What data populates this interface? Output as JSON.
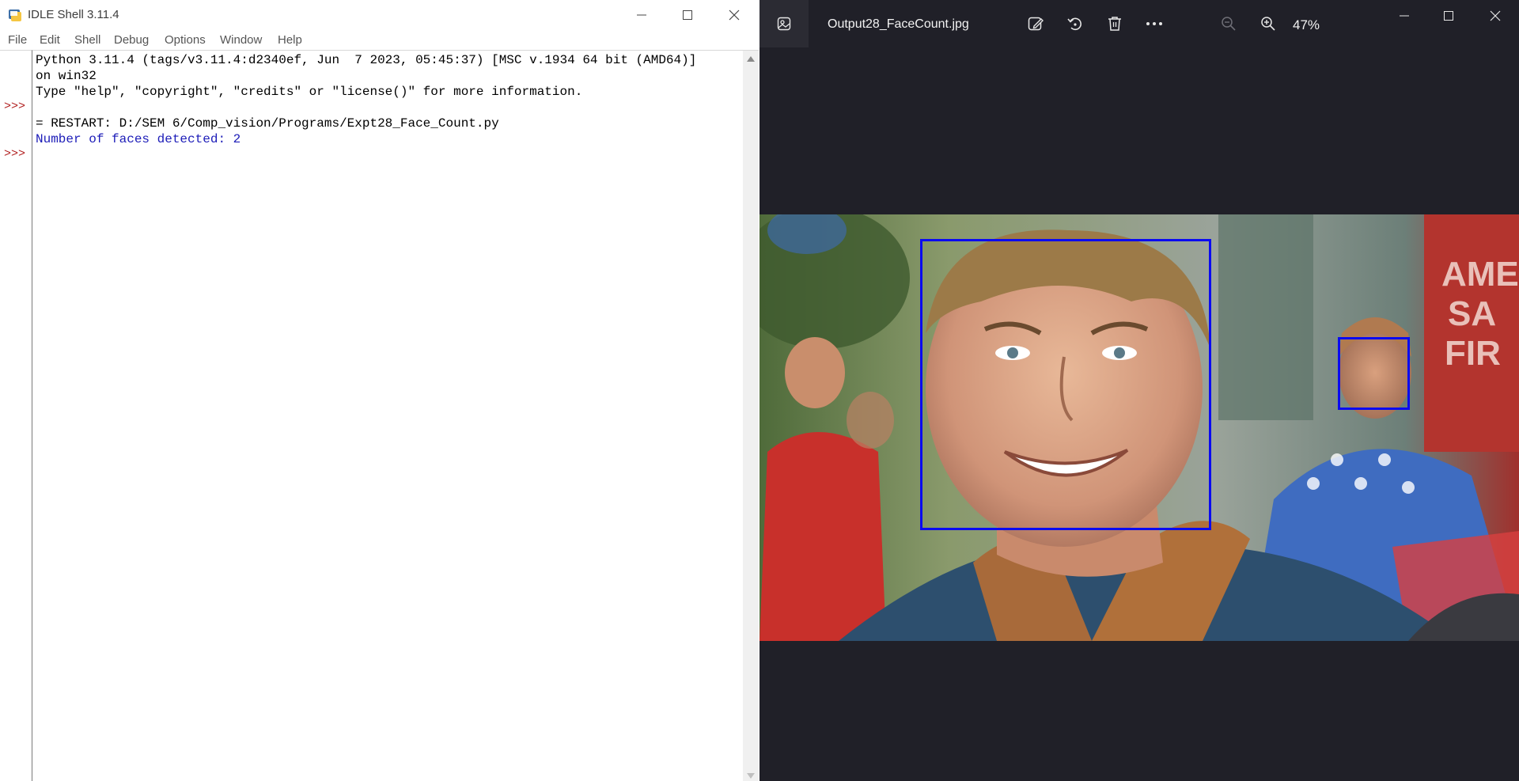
{
  "idle": {
    "title": "IDLE Shell 3.11.4",
    "menu": [
      "File",
      "Edit",
      "Shell",
      "Debug",
      "Options",
      "Window",
      "Help"
    ],
    "prompt_symbol": ">>>",
    "lines": [
      "Python 3.11.4 (tags/v3.11.4:d2340ef, Jun  7 2023, 05:45:37) [MSC v.1934 64 bit (AMD64)]",
      "on win32",
      "Type \"help\", \"copyright\", \"credits\" or \"license()\" for more information.",
      "= RESTART: D:/SEM 6/Comp_vision/Programs/Expt28_Face_Count.py",
      "Number of faces detected: 2"
    ],
    "window_controls": [
      "minimize-icon",
      "maximize-icon",
      "close-icon"
    ]
  },
  "photos": {
    "filename": "Output28_FaceCount.jpg",
    "zoom": "47%",
    "toolbar_icons": [
      "edit-image-icon",
      "rotate-icon",
      "delete-icon",
      "more-icon",
      "zoom-out-icon",
      "zoom-in-icon"
    ],
    "photo_text": "AMER\nSA\nFIR",
    "colors": {
      "background": "#202028",
      "face_box": "#0a0af0"
    }
  }
}
